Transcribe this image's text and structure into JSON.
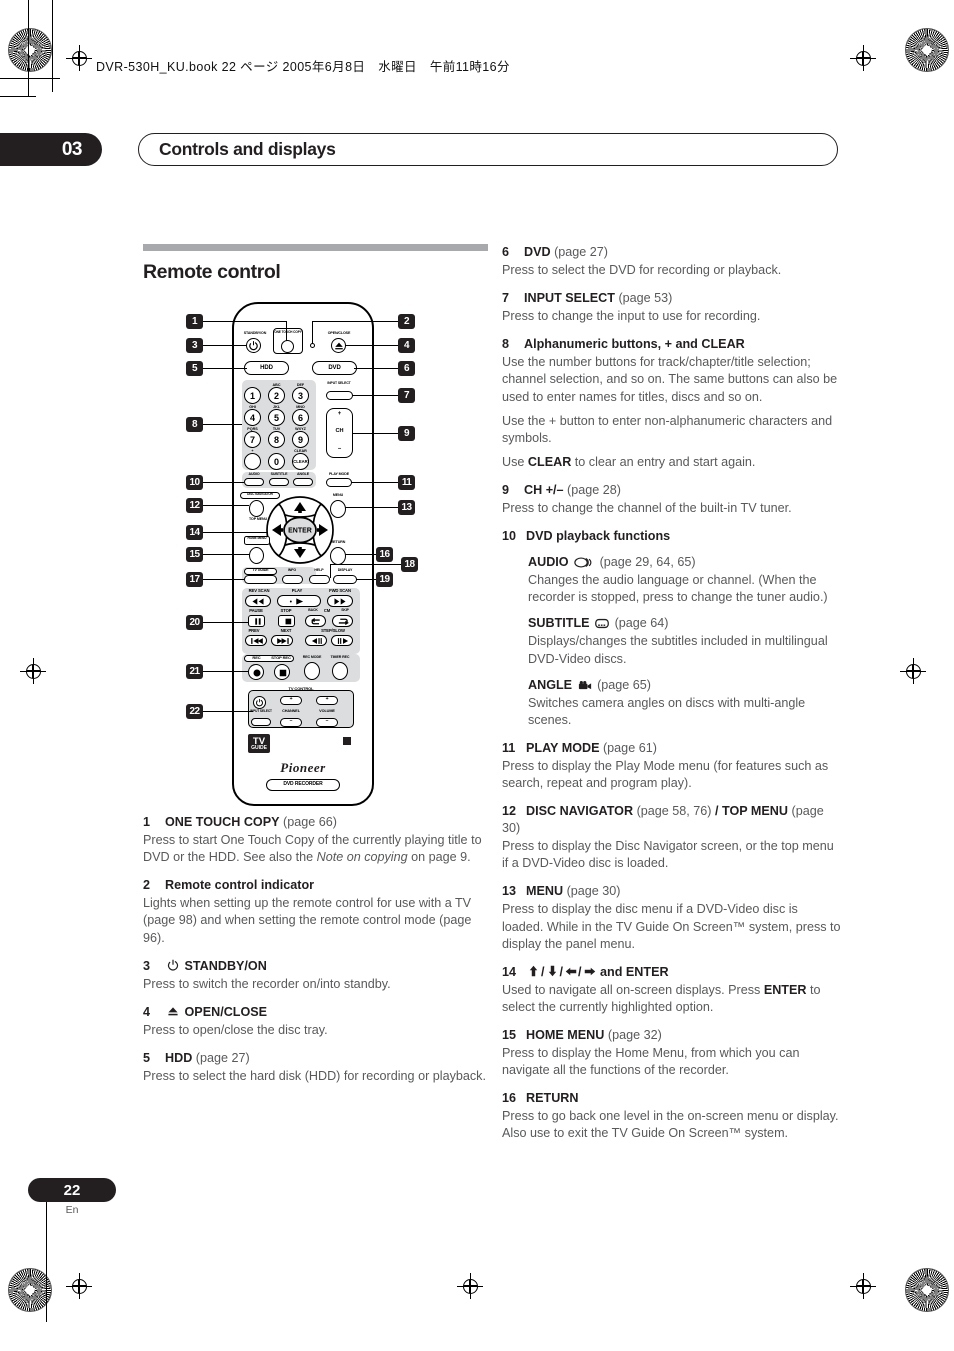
{
  "meta": {
    "book_header": "DVR-530H_KU.book 22 ページ 2005年6月8日　水曜日　午前11時16分",
    "chapter_number": "03",
    "chapter_title": "Controls and displays",
    "folio_page": "22",
    "folio_lang": "En"
  },
  "section": {
    "title": "Remote control"
  },
  "left_entries": [
    {
      "num": "1",
      "term": "ONE TOUCH COPY",
      "page": "(page 66)",
      "body": "Press to start One Touch Copy of the currently playing title to DVD or the HDD. See also the ",
      "body_italic": "Note on copying",
      "body_tail": " on page 9."
    },
    {
      "num": "2",
      "term": "Remote control indicator",
      "page": "",
      "body": "Lights when setting up the remote control for use with a TV (page 98) and when setting the remote control mode (page 96)."
    },
    {
      "num": "3",
      "term": "STANDBY/ON",
      "icon": "power-icon",
      "page": "",
      "body": "Press to switch the recorder on/into standby."
    },
    {
      "num": "4",
      "term": "OPEN/CLOSE",
      "icon": "eject-icon",
      "page": "",
      "body": "Press to open/close the disc tray."
    },
    {
      "num": "5",
      "term": "HDD",
      "page": "(page 27)",
      "body": "Press to select the hard disk (HDD) for recording or playback."
    }
  ],
  "right_entries": [
    {
      "num": "6",
      "term": "DVD",
      "page": "(page 27)",
      "body": "Press to select the DVD for recording or playback."
    },
    {
      "num": "7",
      "term": "INPUT SELECT",
      "page": "(page 53)",
      "body": "Press to change the input to use for recording."
    },
    {
      "num": "8",
      "term": "Alphanumeric buttons, + and CLEAR",
      "page": "",
      "body": "Use the number buttons for track/chapter/title selection; channel selection, and so on. The same buttons can also be used to enter names for titles, discs and so on.",
      "para2": "Use the + button to enter non-alphanumeric characters and symbols.",
      "para3_pre": "Use ",
      "para3_bold": "CLEAR",
      "para3_post": " to clear an entry and start again."
    },
    {
      "num": "9",
      "term": "CH +/–",
      "page": "(page 28)",
      "body": "Press to change the channel of the built-in TV tuner."
    },
    {
      "num": "10",
      "term": "DVD playback functions",
      "page": "",
      "body": "",
      "subs": [
        {
          "term": "AUDIO",
          "icon": "audio-icon",
          "page": "(page 29, 64, 65)",
          "body": "Changes the audio language or channel. (When the recorder is stopped, press to change the tuner audio.)"
        },
        {
          "term": "SUBTITLE",
          "icon": "subtitle-icon",
          "page": "(page 64)",
          "body": "Displays/changes the subtitles included in multilingual DVD-Video discs."
        },
        {
          "term": "ANGLE",
          "icon": "angle-icon",
          "page": "(page 65)",
          "body": "Switches camera angles on discs with multi-angle scenes."
        }
      ]
    },
    {
      "num": "11",
      "term": "PLAY MODE",
      "page": "(page 61)",
      "body": "Press to display the Play Mode menu (for features such as search, repeat and program play)."
    },
    {
      "num": "12",
      "term": "DISC NAVIGATOR",
      "page": "(page 58, 76)",
      "term2": " / TOP MENU",
      "page2": "(page 30)",
      "body": "Press to display the Disc Navigator screen, or the top menu if a DVD-Video disc is loaded."
    },
    {
      "num": "13",
      "term": "MENU",
      "page": "(page 30)",
      "body": "Press to display the disc menu if a DVD-Video disc is loaded. While in the TV Guide On Screen™ system, press to display the panel menu."
    },
    {
      "num": "14",
      "term": "and ENTER",
      "icon": "dpad-arrows-icon",
      "page": "",
      "body_pre": "Used to navigate all on-screen displays. Press ",
      "body_bold": "ENTER",
      "body_post": " to select the currently highlighted option."
    },
    {
      "num": "15",
      "term": "HOME MENU",
      "page": "(page 32)",
      "body": "Press to display the Home Menu, from which you can navigate all the functions of the recorder."
    },
    {
      "num": "16",
      "term": "RETURN",
      "page": "",
      "body": "Press to go back one level in the on-screen menu or display. Also use to exit the TV Guide On Screen™ system."
    }
  ],
  "remote": {
    "callouts": [
      "1",
      "2",
      "3",
      "4",
      "5",
      "6",
      "7",
      "8",
      "9",
      "10",
      "11",
      "12",
      "13",
      "14",
      "15",
      "16",
      "17",
      "18",
      "19",
      "20",
      "21",
      "22"
    ],
    "labels": {
      "standby": "STANDBY/ON",
      "one_touch_copy": "ONE TOUCH COPY",
      "open_close": "OPEN/CLOSE",
      "hdd": "HDD",
      "dvd": "DVD",
      "input_select": "INPUT SELECT",
      "ch": "CH",
      "plus": "+",
      "minus": "–",
      "audio": "AUDIO",
      "subtitle": "SUBTITLE",
      "angle": "ANGLE",
      "play_mode": "PLAY MODE",
      "disc_navigator": "DISC NAVIGATOR",
      "top_menu": "TOP MENU",
      "menu": "MENU",
      "enter": "ENTER",
      "home_menu": "HOME MENU",
      "return": "RETURN",
      "tv_guide": "TV GUIDE",
      "info": "INFO",
      "help": "HELP",
      "display": "DISPLAY",
      "rev_scan": "REV SCAN",
      "play": "PLAY",
      "fwd_scan": "FWD SCAN",
      "pause": "PAUSE",
      "stop": "STOP",
      "back": "BACK",
      "cm": "CM",
      "skip": "SKIP",
      "prev": "PREV",
      "next": "NEXT",
      "step_slow": "STEP/SLOW",
      "rec": "REC",
      "stop_rec": "STOP REC",
      "rec_mode": "REC MODE",
      "timer_rec": "TIMER REC",
      "tv_control": "TV CONTROL",
      "channel": "CHANNEL",
      "volume": "VOLUME",
      "brand": "Pioneer",
      "product": "DVD RECORDER",
      "tvguide_logo_1": "TV",
      "tvguide_logo_2": "GUIDE"
    },
    "keypad": [
      {
        "digit": "1",
        "letters": ""
      },
      {
        "digit": "2",
        "letters": "ABC"
      },
      {
        "digit": "3",
        "letters": "DEF"
      },
      {
        "digit": "4",
        "letters": "GHI"
      },
      {
        "digit": "5",
        "letters": "JKL"
      },
      {
        "digit": "6",
        "letters": "MNO"
      },
      {
        "digit": "7",
        "letters": "PQRS"
      },
      {
        "digit": "8",
        "letters": "TUV"
      },
      {
        "digit": "9",
        "letters": "WXYZ"
      },
      {
        "digit": "",
        "letters": "+"
      },
      {
        "digit": "0",
        "letters": ""
      },
      {
        "digit": "CLEAR",
        "letters": "CLEAR"
      }
    ]
  },
  "colors": {
    "ink": "#231f20",
    "body_text": "#58595b",
    "rule": "#a7a9ac",
    "panel": "#dcdddf"
  }
}
